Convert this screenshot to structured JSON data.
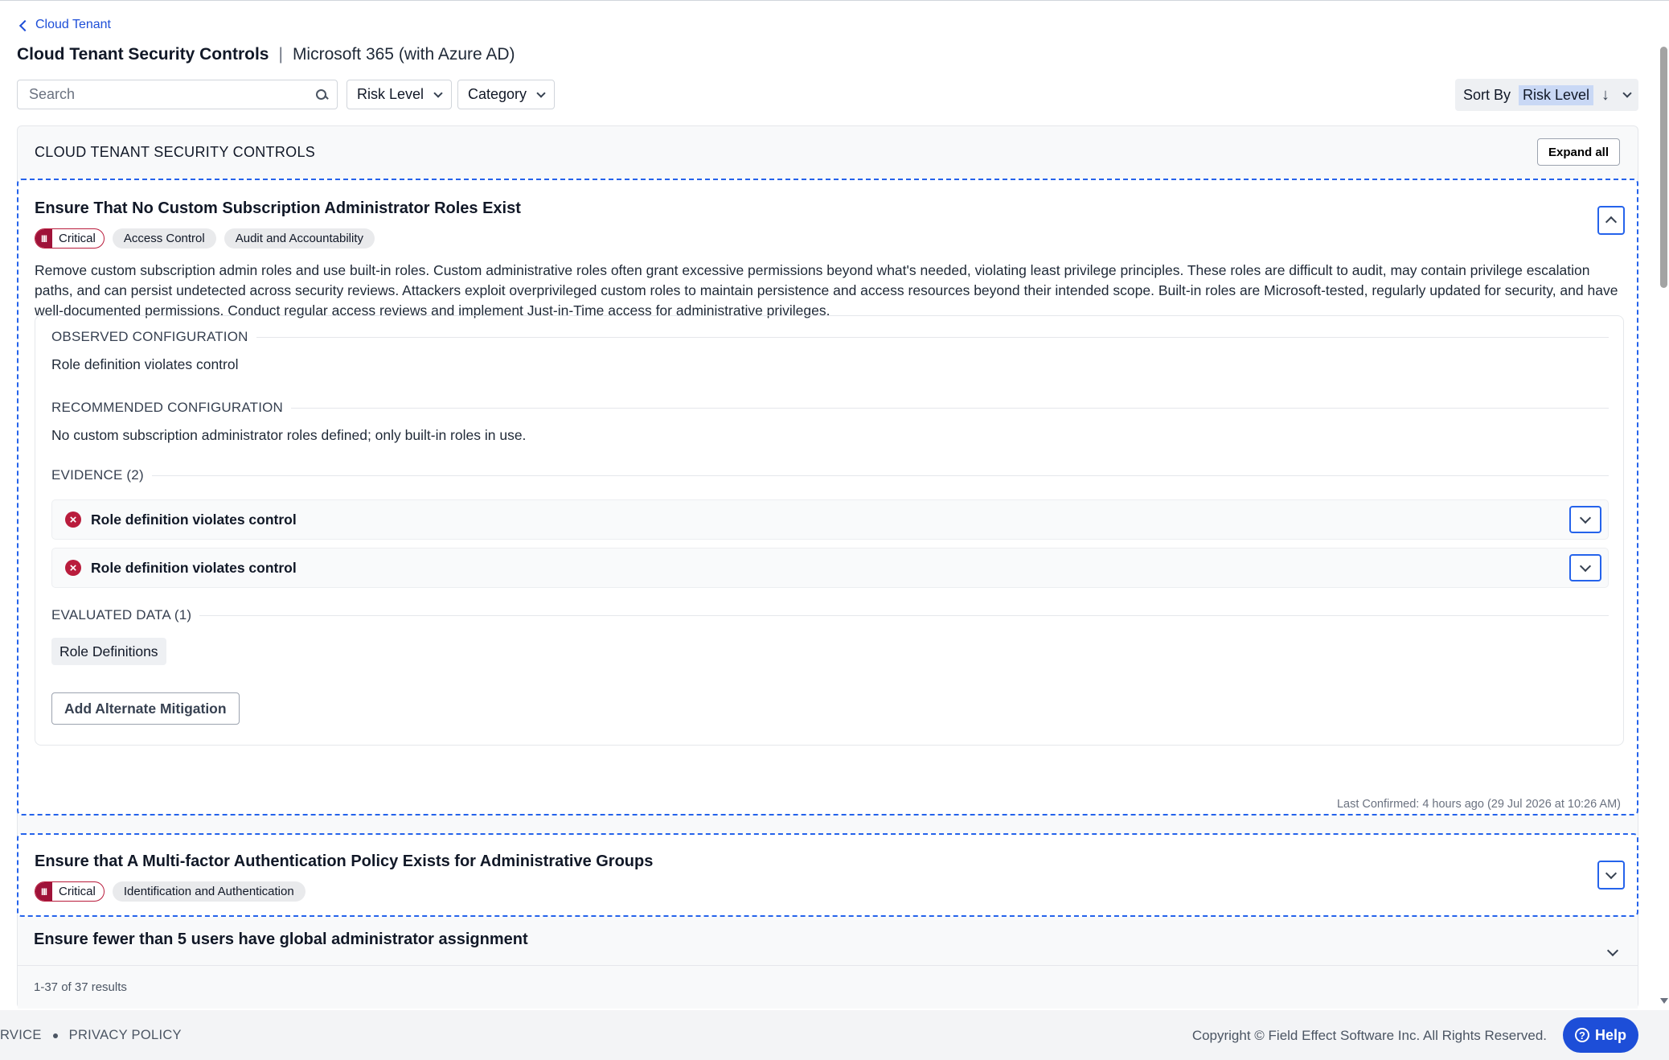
{
  "breadcrumb": {
    "label": "Cloud Tenant"
  },
  "header": {
    "title": "Cloud Tenant Security Controls",
    "separator": "|",
    "subtitle": "Microsoft 365 (with Azure AD)"
  },
  "filters": {
    "search_placeholder": "Search",
    "risk_level_label": "Risk Level",
    "category_label": "Category",
    "sort_by_label": "Sort By",
    "sort_by_value": "Risk Level",
    "sort_direction_icon": "↓"
  },
  "panel": {
    "title": "CLOUD TENANT SECURITY CONTROLS",
    "expand_all_label": "Expand all"
  },
  "controls": [
    {
      "title": "Ensure That No Custom Subscription Administrator Roles Exist",
      "risk": "Critical",
      "risk_icon": "III",
      "categories": [
        "Access Control",
        "Audit and Accountability"
      ],
      "description": "Remove custom subscription admin roles and use built-in roles. Custom administrative roles often grant excessive permissions beyond what's needed, violating least privilege principles. These roles are difficult to audit, may contain privilege escalation paths, and can persist undetected across security reviews. Attackers exploit overprivileged custom roles to maintain persistence and access resources beyond their intended scope. Built-in roles are Microsoft-tested, regularly updated for security, and have well-documented permissions. Conduct regular access reviews and implement Just-in-Time access for administrative privileges.",
      "observed_heading": "OBSERVED CONFIGURATION",
      "observed_value": "Role definition violates control",
      "recommended_heading": "RECOMMENDED CONFIGURATION",
      "recommended_value": "No custom subscription administrator roles defined; only built-in roles in use.",
      "evidence_heading": "EVIDENCE (2)",
      "evidence": [
        "Role definition violates control",
        "Role definition violates control"
      ],
      "evidence_icon": "×",
      "evaluated_heading": "EVALUATED DATA (1)",
      "evaluated_data": [
        "Role Definitions"
      ],
      "mitigation_label": "Add Alternate Mitigation",
      "last_confirmed": "Last Confirmed: 4 hours ago (29 Jul 2026 at 10:26 AM)"
    },
    {
      "title": "Ensure that A Multi-factor Authentication Policy Exists for Administrative Groups",
      "risk": "Critical",
      "risk_icon": "III",
      "categories": [
        "Identification and Authentication"
      ]
    },
    {
      "title": "Ensure fewer than 5 users have global administrator assignment"
    }
  ],
  "results": "1-37 of 37 results",
  "footer": {
    "link_service": "RVICE",
    "link_privacy": "PRIVACY POLICY",
    "copyright": "Copyright © Field Effect Software Inc. All Rights Reserved.",
    "help_label": "Help",
    "help_icon": "?"
  },
  "colors": {
    "accent": "#2563eb",
    "critical": "#9f1239",
    "link": "#1d4ed8"
  }
}
